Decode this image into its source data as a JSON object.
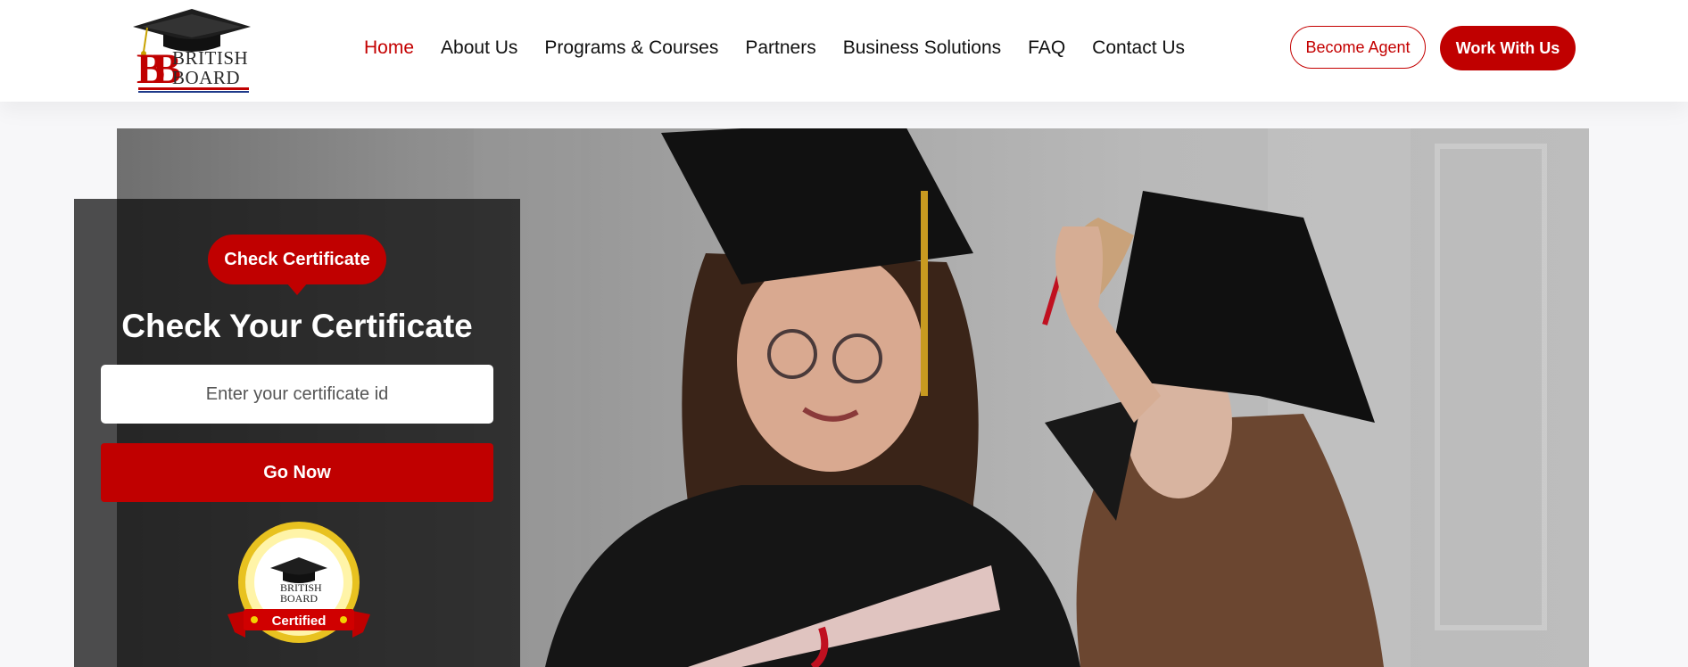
{
  "header": {
    "logo": {
      "line1": "BRITISH",
      "line2": "BOARD",
      "monogram": "BB"
    },
    "nav": [
      {
        "label": "Home",
        "active": true
      },
      {
        "label": "About Us"
      },
      {
        "label": "Programs & Courses"
      },
      {
        "label": "Partners"
      },
      {
        "label": "Business Solutions"
      },
      {
        "label": "FAQ"
      },
      {
        "label": "Contact Us"
      }
    ],
    "become_agent_label": "Become Agent",
    "work_with_us_label": "Work With Us"
  },
  "certificate_panel": {
    "badge_label": "Check Certificate",
    "title": "Check Your Certificate",
    "input_placeholder": "Enter your certificate id",
    "input_value": "",
    "submit_label": "Go Now",
    "seal": {
      "line1": "BRITISH",
      "line2": "BOARD",
      "ribbon": "Certified"
    }
  },
  "colors": {
    "brand_red": "#c00000",
    "nav_active": "#c40000",
    "text_dark": "#111111"
  }
}
